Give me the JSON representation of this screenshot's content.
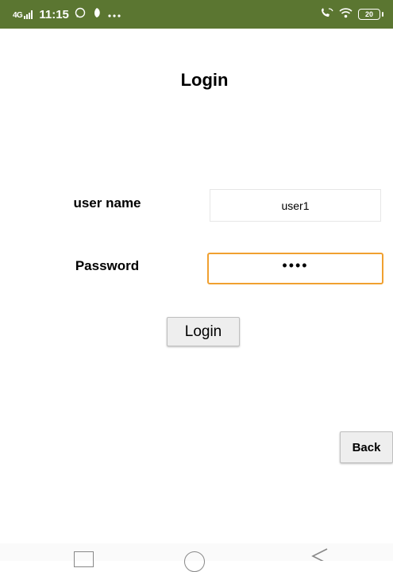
{
  "status_bar": {
    "signal_label": "4G",
    "time": "11:15",
    "notification_icons": [
      "whatsapp-icon",
      "app-icon",
      "more-icon"
    ],
    "battery": "20",
    "background": "#5b7631"
  },
  "page": {
    "title": "Login"
  },
  "form": {
    "username_label": "user name",
    "username_value": "user1",
    "password_label": "Password",
    "password_value": "••••",
    "login_button": "Login",
    "accent_color": "#f0a030"
  },
  "back_button": "Back",
  "nav_bar": [
    "recent-apps-icon",
    "home-icon",
    "back-icon"
  ]
}
